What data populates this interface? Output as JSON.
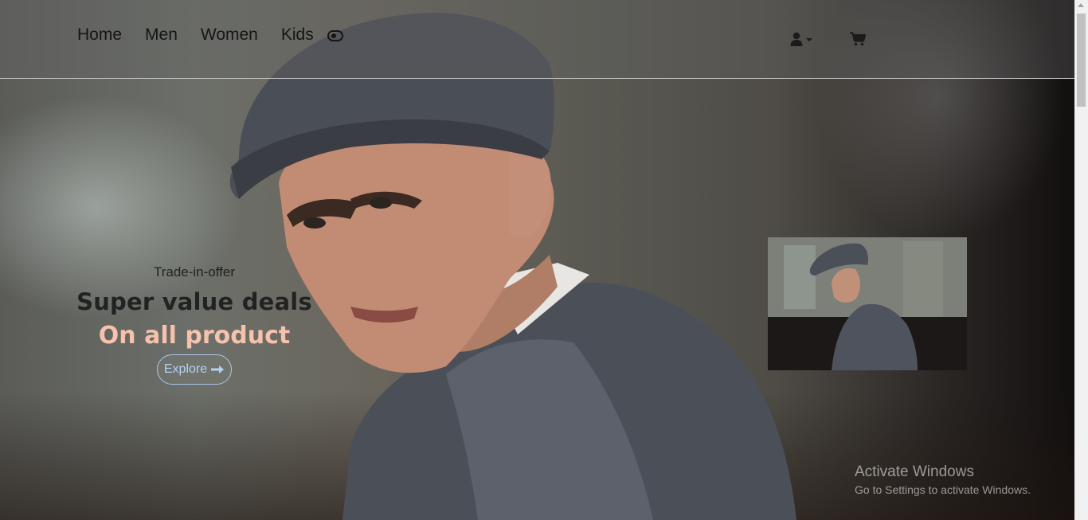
{
  "header": {
    "nav_links": [
      {
        "label": "Home"
      },
      {
        "label": "Men"
      },
      {
        "label": "Women"
      },
      {
        "label": "Kids"
      }
    ],
    "toggle_icon": "toggle-icon",
    "user_icon": "user-icon",
    "cart_icon": "cart-icon"
  },
  "hero": {
    "kicker": "Trade-in-offer",
    "headline": "Super value deals",
    "subline": "On all product",
    "button_label": "Explore",
    "button_icon": "arrow-right-icon"
  },
  "watermark": {
    "title": "Activate Windows",
    "subtitle": "Go to Settings to activate Windows."
  },
  "colors": {
    "subline": "#f6c1ad",
    "button_border": "#a9c7e8",
    "text_dark": "#222222"
  }
}
